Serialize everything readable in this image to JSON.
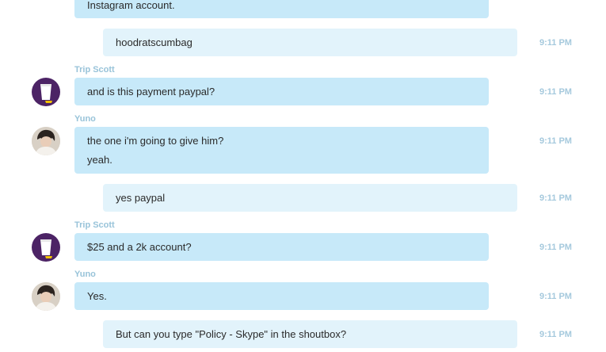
{
  "messages": [
    {
      "kind": "in-partial",
      "lines": [
        "Instagram account."
      ]
    },
    {
      "kind": "out",
      "lines": [
        "hoodratscumbag"
      ],
      "time": "9:11 PM"
    },
    {
      "kind": "in",
      "sender": "Trip Scott",
      "avatar": "purple-cup-avatar",
      "lines": [
        "and is this payment paypal?"
      ],
      "time": "9:11 PM"
    },
    {
      "kind": "in",
      "sender": "Yuno",
      "avatar": "person-photo-avatar",
      "lines": [
        "the one i'm going to give him?",
        "yeah."
      ],
      "time": "9:11 PM"
    },
    {
      "kind": "out",
      "lines": [
        "yes paypal"
      ],
      "time": "9:11 PM"
    },
    {
      "kind": "in",
      "sender": "Trip Scott",
      "avatar": "purple-cup-avatar",
      "lines": [
        "$25 and a 2k account?"
      ],
      "time": "9:11 PM"
    },
    {
      "kind": "in",
      "sender": "Yuno",
      "avatar": "person-photo-avatar",
      "lines": [
        "Yes."
      ],
      "time": "9:11 PM"
    },
    {
      "kind": "out",
      "lines": [
        "But can you type \"Policy - Skype\" in the shoutbox?"
      ],
      "time": "9:11 PM"
    }
  ],
  "colors": {
    "incoming_bubble": "#c7e9f9",
    "outgoing_bubble": "#e2f3fb",
    "sender_name": "#98c3d9",
    "timestamp": "#a5c9dd"
  }
}
